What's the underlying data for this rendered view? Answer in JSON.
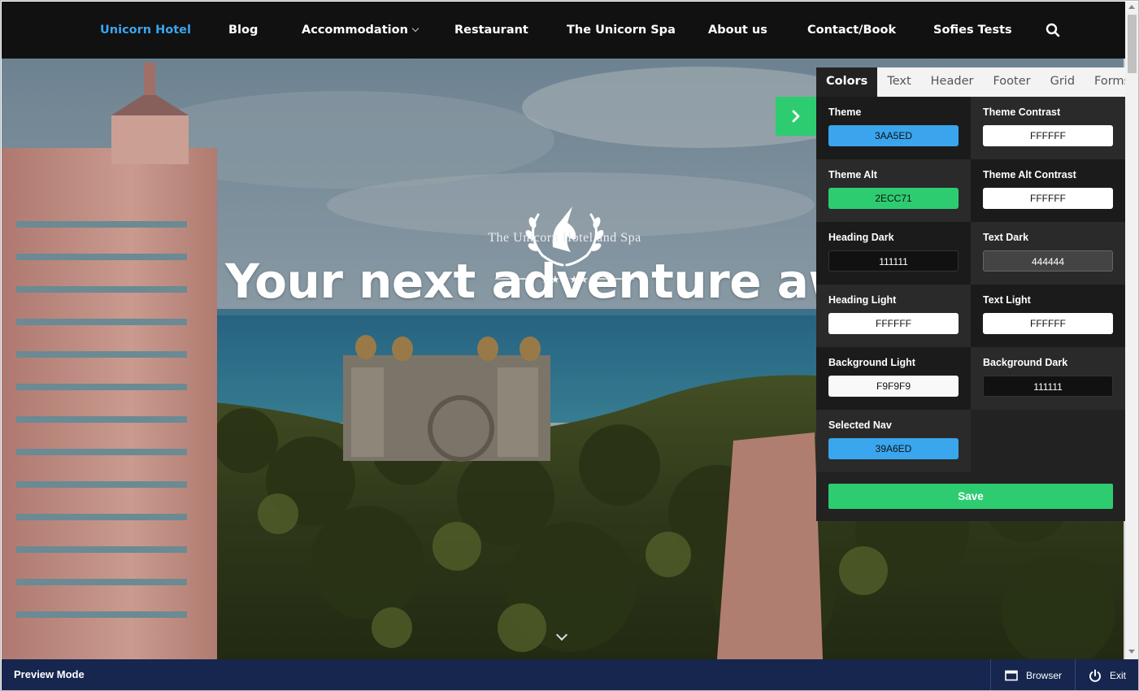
{
  "nav": {
    "items": [
      {
        "label": "Unicorn Hotel",
        "active": true
      },
      {
        "label": "Blog"
      },
      {
        "label": "Accommodation",
        "dropdown": true
      },
      {
        "label": "Restaurant"
      },
      {
        "label": "The Unicorn Spa"
      },
      {
        "label": "About us"
      },
      {
        "label": "Contact/Book"
      },
      {
        "label": "Sofies Tests"
      }
    ],
    "search_icon": "search-icon"
  },
  "hero": {
    "logo_stars": "★★★★★",
    "hotel_name": "The Unicorn Hotel and Spa",
    "headline": "Your next adventure aw"
  },
  "panel": {
    "tabs": [
      "Colors",
      "Text",
      "Header",
      "Footer",
      "Grid",
      "Forms"
    ],
    "active_tab": "Colors",
    "fields": [
      {
        "label": "Theme",
        "value": "3AA5ED",
        "bg": "#3AA5ED",
        "fg": "#111111"
      },
      {
        "label": "Theme Contrast",
        "value": "FFFFFF",
        "bg": "#FFFFFF",
        "fg": "#111111"
      },
      {
        "label": "Theme Alt",
        "value": "2ECC71",
        "bg": "#2ECC71",
        "fg": "#111111"
      },
      {
        "label": "Theme Alt Contrast",
        "value": "FFFFFF",
        "bg": "#FFFFFF",
        "fg": "#111111"
      },
      {
        "label": "Heading Dark",
        "value": "111111",
        "bg": "#111111",
        "fg": "#FFFFFF"
      },
      {
        "label": "Text Dark",
        "value": "444444",
        "bg": "#444444",
        "fg": "#FFFFFF"
      },
      {
        "label": "Heading Light",
        "value": "FFFFFF",
        "bg": "#FFFFFF",
        "fg": "#111111"
      },
      {
        "label": "Text Light",
        "value": "FFFFFF",
        "bg": "#FFFFFF",
        "fg": "#111111"
      },
      {
        "label": "Background Light",
        "value": "F9F9F9",
        "bg": "#F9F9F9",
        "fg": "#111111"
      },
      {
        "label": "Background Dark",
        "value": "111111",
        "bg": "#111111",
        "fg": "#FFFFFF"
      },
      {
        "label": "Selected Nav",
        "value": "39A6ED",
        "bg": "#39A6ED",
        "fg": "#111111"
      }
    ],
    "save_label": "Save"
  },
  "bottom_bar": {
    "preview_label": "Preview Mode",
    "browser_label": "Browser",
    "exit_label": "Exit"
  },
  "colors": {
    "nav_bg": "#111111",
    "accent": "#3AA5ED",
    "accent_alt": "#2ECC71",
    "panel_bg": "#222222",
    "bottom_bar": "#16264E"
  }
}
